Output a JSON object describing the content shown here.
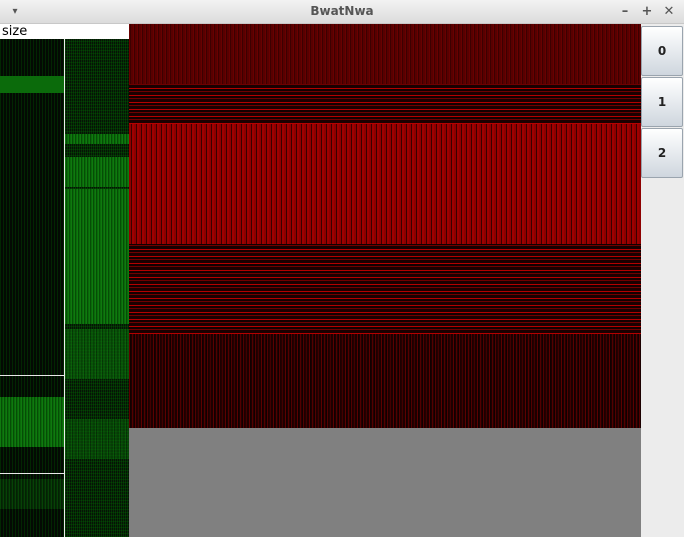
{
  "window": {
    "title": "BwatNwa",
    "menu_icon": "▾",
    "minimize_icon": "–",
    "maximize_icon": "+",
    "close_icon": "✕"
  },
  "panel": {
    "size_label": "size"
  },
  "tabs": [
    {
      "label": "0"
    },
    {
      "label": "1"
    },
    {
      "label": "2"
    }
  ],
  "colors": {
    "dendrogram_green": "#0b6b0b",
    "heatmap_red": "#b40000",
    "empty_area": "#808080"
  }
}
